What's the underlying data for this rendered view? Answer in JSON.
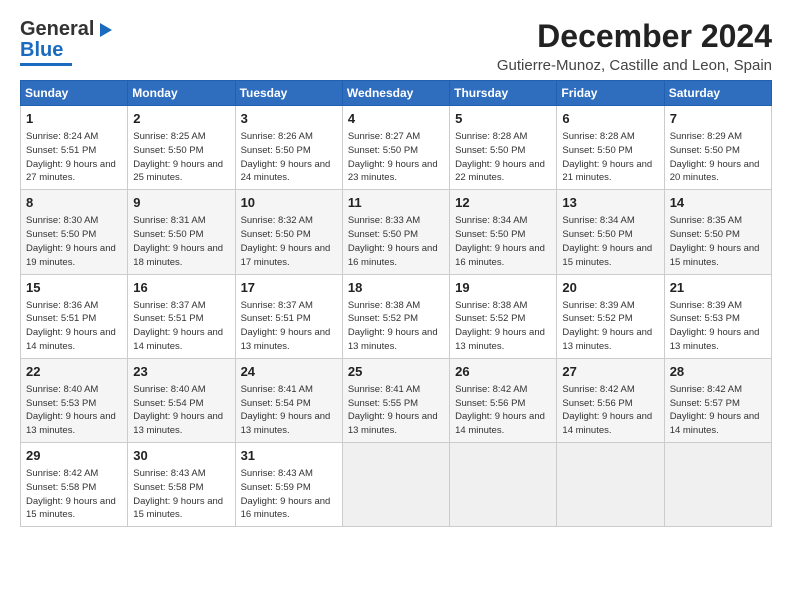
{
  "header": {
    "logo_general": "General",
    "logo_blue": "Blue",
    "title": "December 2024",
    "subtitle": "Gutierre-Munoz, Castille and Leon, Spain"
  },
  "weekdays": [
    "Sunday",
    "Monday",
    "Tuesday",
    "Wednesday",
    "Thursday",
    "Friday",
    "Saturday"
  ],
  "weeks": [
    [
      {
        "day": "1",
        "sunrise": "Sunrise: 8:24 AM",
        "sunset": "Sunset: 5:51 PM",
        "daylight": "Daylight: 9 hours and 27 minutes."
      },
      {
        "day": "2",
        "sunrise": "Sunrise: 8:25 AM",
        "sunset": "Sunset: 5:50 PM",
        "daylight": "Daylight: 9 hours and 25 minutes."
      },
      {
        "day": "3",
        "sunrise": "Sunrise: 8:26 AM",
        "sunset": "Sunset: 5:50 PM",
        "daylight": "Daylight: 9 hours and 24 minutes."
      },
      {
        "day": "4",
        "sunrise": "Sunrise: 8:27 AM",
        "sunset": "Sunset: 5:50 PM",
        "daylight": "Daylight: 9 hours and 23 minutes."
      },
      {
        "day": "5",
        "sunrise": "Sunrise: 8:28 AM",
        "sunset": "Sunset: 5:50 PM",
        "daylight": "Daylight: 9 hours and 22 minutes."
      },
      {
        "day": "6",
        "sunrise": "Sunrise: 8:28 AM",
        "sunset": "Sunset: 5:50 PM",
        "daylight": "Daylight: 9 hours and 21 minutes."
      },
      {
        "day": "7",
        "sunrise": "Sunrise: 8:29 AM",
        "sunset": "Sunset: 5:50 PM",
        "daylight": "Daylight: 9 hours and 20 minutes."
      }
    ],
    [
      {
        "day": "8",
        "sunrise": "Sunrise: 8:30 AM",
        "sunset": "Sunset: 5:50 PM",
        "daylight": "Daylight: 9 hours and 19 minutes."
      },
      {
        "day": "9",
        "sunrise": "Sunrise: 8:31 AM",
        "sunset": "Sunset: 5:50 PM",
        "daylight": "Daylight: 9 hours and 18 minutes."
      },
      {
        "day": "10",
        "sunrise": "Sunrise: 8:32 AM",
        "sunset": "Sunset: 5:50 PM",
        "daylight": "Daylight: 9 hours and 17 minutes."
      },
      {
        "day": "11",
        "sunrise": "Sunrise: 8:33 AM",
        "sunset": "Sunset: 5:50 PM",
        "daylight": "Daylight: 9 hours and 16 minutes."
      },
      {
        "day": "12",
        "sunrise": "Sunrise: 8:34 AM",
        "sunset": "Sunset: 5:50 PM",
        "daylight": "Daylight: 9 hours and 16 minutes."
      },
      {
        "day": "13",
        "sunrise": "Sunrise: 8:34 AM",
        "sunset": "Sunset: 5:50 PM",
        "daylight": "Daylight: 9 hours and 15 minutes."
      },
      {
        "day": "14",
        "sunrise": "Sunrise: 8:35 AM",
        "sunset": "Sunset: 5:50 PM",
        "daylight": "Daylight: 9 hours and 15 minutes."
      }
    ],
    [
      {
        "day": "15",
        "sunrise": "Sunrise: 8:36 AM",
        "sunset": "Sunset: 5:51 PM",
        "daylight": "Daylight: 9 hours and 14 minutes."
      },
      {
        "day": "16",
        "sunrise": "Sunrise: 8:37 AM",
        "sunset": "Sunset: 5:51 PM",
        "daylight": "Daylight: 9 hours and 14 minutes."
      },
      {
        "day": "17",
        "sunrise": "Sunrise: 8:37 AM",
        "sunset": "Sunset: 5:51 PM",
        "daylight": "Daylight: 9 hours and 13 minutes."
      },
      {
        "day": "18",
        "sunrise": "Sunrise: 8:38 AM",
        "sunset": "Sunset: 5:52 PM",
        "daylight": "Daylight: 9 hours and 13 minutes."
      },
      {
        "day": "19",
        "sunrise": "Sunrise: 8:38 AM",
        "sunset": "Sunset: 5:52 PM",
        "daylight": "Daylight: 9 hours and 13 minutes."
      },
      {
        "day": "20",
        "sunrise": "Sunrise: 8:39 AM",
        "sunset": "Sunset: 5:52 PM",
        "daylight": "Daylight: 9 hours and 13 minutes."
      },
      {
        "day": "21",
        "sunrise": "Sunrise: 8:39 AM",
        "sunset": "Sunset: 5:53 PM",
        "daylight": "Daylight: 9 hours and 13 minutes."
      }
    ],
    [
      {
        "day": "22",
        "sunrise": "Sunrise: 8:40 AM",
        "sunset": "Sunset: 5:53 PM",
        "daylight": "Daylight: 9 hours and 13 minutes."
      },
      {
        "day": "23",
        "sunrise": "Sunrise: 8:40 AM",
        "sunset": "Sunset: 5:54 PM",
        "daylight": "Daylight: 9 hours and 13 minutes."
      },
      {
        "day": "24",
        "sunrise": "Sunrise: 8:41 AM",
        "sunset": "Sunset: 5:54 PM",
        "daylight": "Daylight: 9 hours and 13 minutes."
      },
      {
        "day": "25",
        "sunrise": "Sunrise: 8:41 AM",
        "sunset": "Sunset: 5:55 PM",
        "daylight": "Daylight: 9 hours and 13 minutes."
      },
      {
        "day": "26",
        "sunrise": "Sunrise: 8:42 AM",
        "sunset": "Sunset: 5:56 PM",
        "daylight": "Daylight: 9 hours and 14 minutes."
      },
      {
        "day": "27",
        "sunrise": "Sunrise: 8:42 AM",
        "sunset": "Sunset: 5:56 PM",
        "daylight": "Daylight: 9 hours and 14 minutes."
      },
      {
        "day": "28",
        "sunrise": "Sunrise: 8:42 AM",
        "sunset": "Sunset: 5:57 PM",
        "daylight": "Daylight: 9 hours and 14 minutes."
      }
    ],
    [
      {
        "day": "29",
        "sunrise": "Sunrise: 8:42 AM",
        "sunset": "Sunset: 5:58 PM",
        "daylight": "Daylight: 9 hours and 15 minutes."
      },
      {
        "day": "30",
        "sunrise": "Sunrise: 8:43 AM",
        "sunset": "Sunset: 5:58 PM",
        "daylight": "Daylight: 9 hours and 15 minutes."
      },
      {
        "day": "31",
        "sunrise": "Sunrise: 8:43 AM",
        "sunset": "Sunset: 5:59 PM",
        "daylight": "Daylight: 9 hours and 16 minutes."
      },
      null,
      null,
      null,
      null
    ]
  ]
}
